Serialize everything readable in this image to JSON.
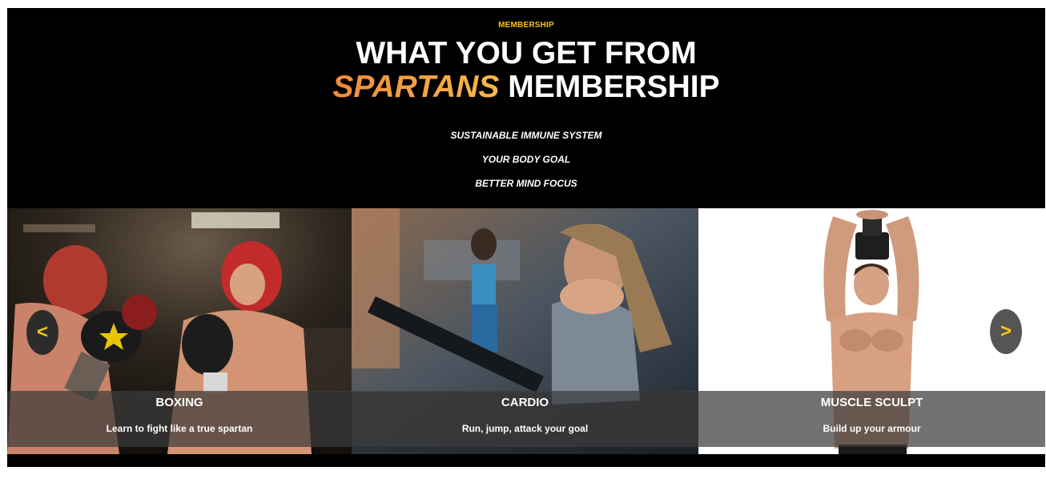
{
  "theme": {
    "accent": "#f5c518",
    "brand_gradient_start": "#f08a3c",
    "brand_gradient_end": "#f6b84a",
    "background": "#000000",
    "text": "#ffffff"
  },
  "header": {
    "eyebrow": "MEMBERSHIP",
    "line1": "WHAT YOU GET FROM",
    "brand": "SPARTANS",
    "line2_rest": "MEMBERSHIP"
  },
  "benefits": [
    "SUSTAINABLE IMMUNE SYSTEM",
    "YOUR BODY GOAL",
    "BETTER MIND FOCUS"
  ],
  "slider": {
    "prev_icon": "chevron-left-icon",
    "prev_label": "<",
    "next_icon": "chevron-right-icon",
    "next_label": ">",
    "cards": [
      {
        "title": "BOXING",
        "description": "Learn to fight like a true spartan",
        "image": "boxing-photo"
      },
      {
        "title": "CARDIO",
        "description": "Run, jump, attack your goal",
        "image": "treadmill-photo"
      },
      {
        "title": "MUSCLE SCULPT",
        "description": "Build up your armour",
        "image": "dumbbell-photo"
      }
    ]
  }
}
